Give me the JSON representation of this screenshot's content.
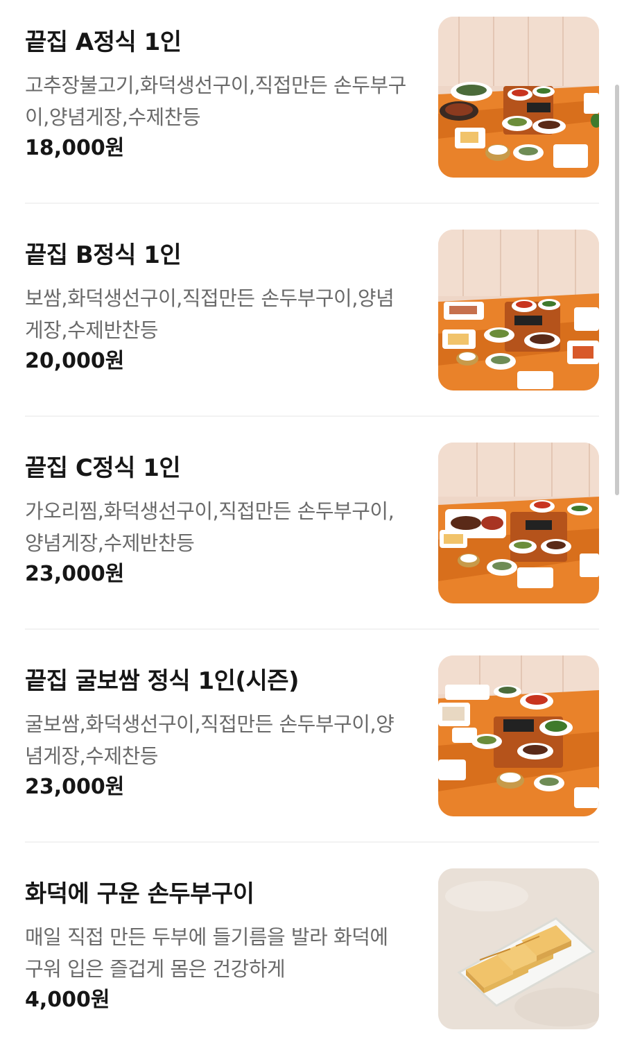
{
  "menu": {
    "items": [
      {
        "name": "끝집 A정식 1인",
        "description": "고추장불고기,화덕생선구이,직접만든 손두부구이,양념게장,수제찬등",
        "price": "18,000원",
        "image": "hansik-table-set-photo"
      },
      {
        "name": "끝집 B정식 1인",
        "description": "보쌈,화덕생선구이,직접만든 손두부구이,양념게장,수제반찬등",
        "price": "20,000원",
        "image": "hansik-table-set-photo"
      },
      {
        "name": "끝집 C정식 1인",
        "description": "가오리찜,화덕생선구이,직접만든 손두부구이,양념게장,수제반찬등",
        "price": "23,000원",
        "image": "hansik-table-set-photo"
      },
      {
        "name": "끝집 굴보쌈 정식 1인(시즌)",
        "description": "굴보쌈,화덕생선구이,직접만든 손두부구이,양념게장,수제찬등",
        "price": "23,000원",
        "image": "hansik-table-set-photo"
      },
      {
        "name": "화덕에 구운 손두부구이",
        "description": "매일 직접 만든 두부에 들기름을 발라 화덕에 구워 입은 즐겁게 몸은 건강하게",
        "price": "4,000원",
        "image": "grilled-tofu-photo"
      }
    ]
  },
  "colors": {
    "wall": "#eed6c7",
    "table": "#e9822a",
    "plate": "#ffffff",
    "kimchi": "#c8341f",
    "greens": "#3f7a2c",
    "tofu": "#f1c36a",
    "tofu_bg": "#ece4dc"
  }
}
